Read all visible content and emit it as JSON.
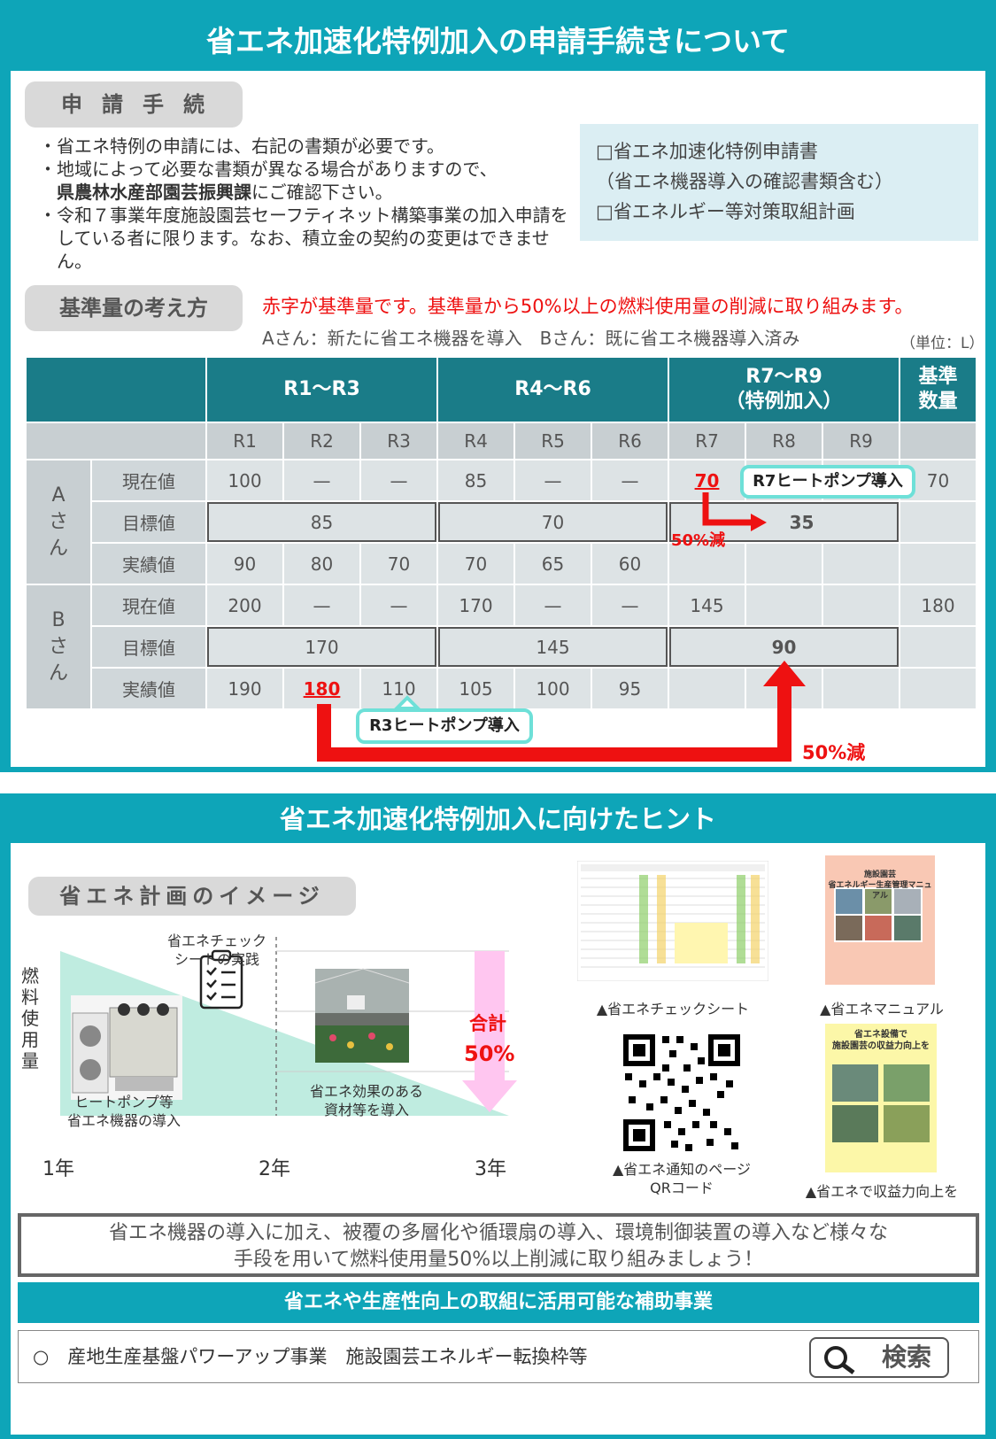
{
  "header": {
    "title": "省エネ加速化特例加入の申請手続きについて"
  },
  "procedure": {
    "pill": "申請手続",
    "bullets": [
      "・省エネ特例の申請には、右記の書類が必要です。",
      "・地域によって必要な書類が異なる場合がありますので、",
      "県農林水産部園芸振興課",
      "にご確認下さい。",
      "・令和７事業年度施設園芸セーフティネット構築事業の加入申請をしている者に限ります。なお、積立金の契約の変更はできません。"
    ],
    "documents": [
      "□省エネ加速化特例申請書",
      "（省エネ機器導入の確認書類含む）",
      "□省エネルギー等対策取組計画"
    ]
  },
  "baseline": {
    "pill": "基準量の考え方",
    "red_note": "赤字が基準量です。基準量から50%以上の燃料使用量の削減に取り組みます。",
    "sub_note": "Aさん：新たに省エネ機器を導入　Bさん：既に省エネ機器導入済み",
    "unit": "（単位：L）"
  },
  "table": {
    "group_headers": [
      "R1〜R3",
      "R4〜R6",
      "R7〜R9",
      "（特例加入）",
      "基準",
      "数量"
    ],
    "years": [
      "R1",
      "R2",
      "R3",
      "R4",
      "R5",
      "R6",
      "R7",
      "R8",
      "R9"
    ],
    "row_labels": [
      "現在値",
      "目標値",
      "実績値"
    ],
    "personA": {
      "name": [
        "A",
        "さ",
        "ん"
      ],
      "current": [
        "100",
        "—",
        "—",
        "85",
        "—",
        "—",
        "70",
        "",
        "",
        "70"
      ],
      "target": [
        "85",
        "70",
        "35"
      ],
      "actual": [
        "90",
        "80",
        "70",
        "70",
        "65",
        "60"
      ]
    },
    "personB": {
      "name": [
        "B",
        "さ",
        "ん"
      ],
      "current": [
        "200",
        "—",
        "—",
        "170",
        "—",
        "—",
        "145",
        "",
        "",
        "180"
      ],
      "target": [
        "170",
        "145",
        "90"
      ],
      "actual": [
        "190",
        "180",
        "110",
        "105",
        "100",
        "95"
      ]
    },
    "callout_a": "R7ヒートポンプ導入",
    "callout_b": "R3ヒートポンプ導入",
    "reduce_a": "50%減",
    "reduce_b": "50%減"
  },
  "hints": {
    "title": "省エネ加速化特例加入に向けたヒント",
    "pill": "省エネ計画のイメージ",
    "ylabel": [
      "燃",
      "料",
      "使",
      "用",
      "量"
    ],
    "check_label": [
      "省エネチェック",
      "シートの実践"
    ],
    "heatpump_label": [
      "ヒートポンプ等",
      "省エネ機器の導入"
    ],
    "material_label": [
      "省エネ効果のある",
      "資材等を導入"
    ],
    "total_label": "合計",
    "total_value": "50%",
    "x_ticks": [
      "1年",
      "2年",
      "3年"
    ],
    "captions": {
      "check_sheet": "▲省エネチェックシート",
      "manual": "▲省エネマニュアル",
      "qr": [
        "▲省エネ通知のページ",
        "QRコード"
      ],
      "profit": "▲省エネで収益力向上を"
    },
    "manual_title": [
      "施設園芸",
      "省エネルギー生産管理マニュアル"
    ],
    "profit_title": [
      "省エネ設備で",
      "施設園芸の収益力向上を"
    ]
  },
  "message": [
    "省エネ機器の導入に加え、被覆の多層化や循環扇の導入、環境制御装置の導入など様々な",
    "手段を用いて燃料使用量50%以上削減に取り組みましょう！"
  ],
  "subsidy": {
    "title": "省エネや生産性向上の取組に活用可能な補助事業",
    "item": "○　産地生産基盤パワーアップ事業　施設園芸エネルギー転換枠等",
    "search_label": "検索"
  },
  "colors": {
    "teal": "#0ea5b8",
    "dark_teal": "#1a7c88",
    "red": "#ee1111",
    "mint": "#6ee0d8",
    "pink": "#ffc6f0"
  }
}
